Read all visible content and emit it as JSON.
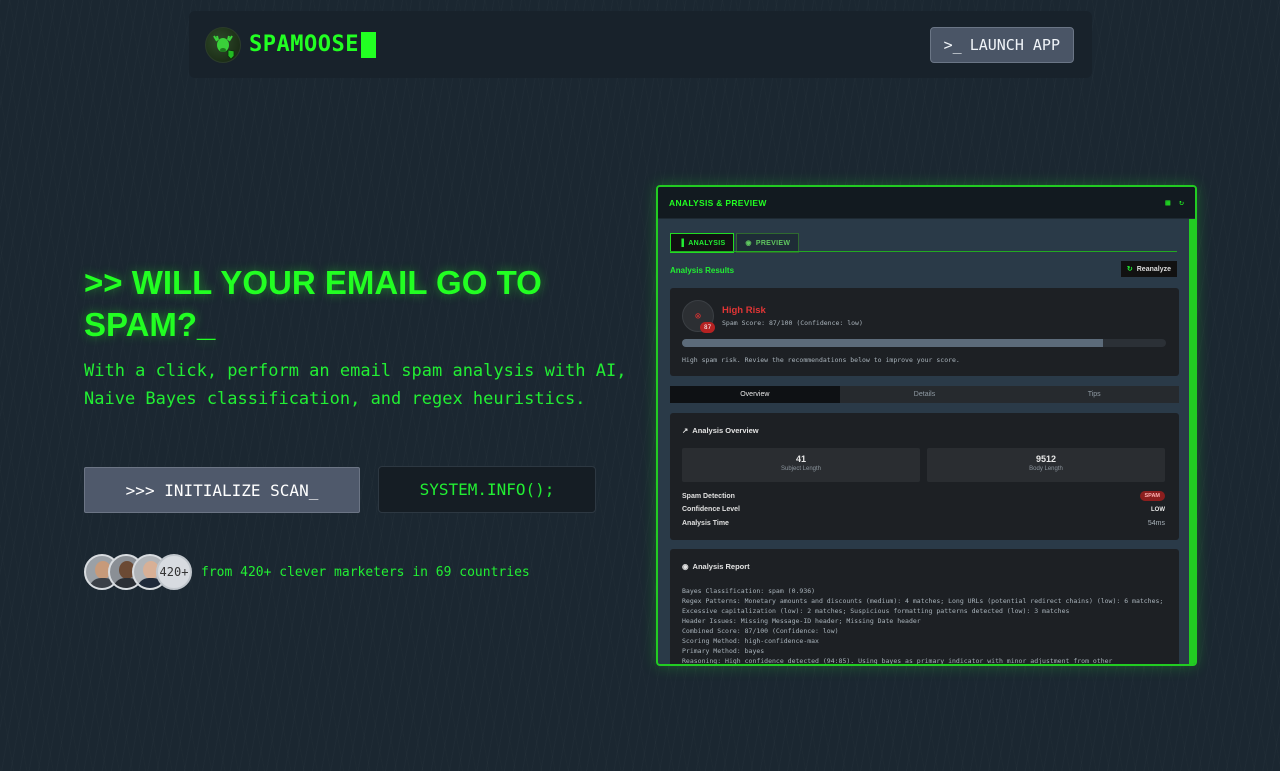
{
  "nav": {
    "brand": "SPAMOOSE",
    "launch_label": "LAUNCH APP",
    "launch_icon": "terminal-icon"
  },
  "hero": {
    "title_line1": ">> WILL YOUR EMAIL GO TO",
    "title_line2": "SPAM?_",
    "subtitle": "With a click, perform an email spam analysis with AI, Naive Bayes classification, and regex heuristics.",
    "primary_button": ">>> INITIALIZE SCAN_",
    "secondary_button": "SYSTEM.INFO();",
    "avatar_count": "420+",
    "social_text": "from 420+ clever marketers in 69 countries"
  },
  "colors": {
    "accent": "#22ff22",
    "background": "#1b2731",
    "danger": "#e03535"
  },
  "panel": {
    "title": "ANALYSIS & PREVIEW",
    "tabs": [
      {
        "label": "ANALYSIS",
        "icon": "bar-chart-icon",
        "active": true
      },
      {
        "label": "PREVIEW",
        "icon": "eye-icon",
        "active": false
      }
    ],
    "results_label": "Analysis Results",
    "reanalyze_label": "Reanalyze",
    "risk": {
      "title": "High Risk",
      "score_text": "Spam Score: 87/100 (Confidence: low)",
      "badge": "87",
      "progress": 0.87,
      "message": "High spam risk. Review the recommendations below to improve your score."
    },
    "subtabs": [
      "Overview",
      "Details",
      "Tips"
    ],
    "overview": {
      "title": "Analysis Overview",
      "stats": [
        {
          "value": "41",
          "label": "Subject Length"
        },
        {
          "value": "9512",
          "label": "Body Length"
        }
      ],
      "rows": [
        {
          "key": "Spam Detection",
          "value": "SPAM"
        },
        {
          "key": "Confidence Level",
          "value": "LOW"
        },
        {
          "key": "Analysis Time",
          "value": "54ms"
        }
      ]
    },
    "report": {
      "title": "Analysis Report",
      "lines": [
        "Bayes Classification: spam (0.936)",
        "Regex Patterns: Monetary amounts and discounts (medium): 4 matches; Long URLs (potential redirect chains) (low): 6 matches; Excessive capitalization (low): 2 matches; Suspicious formatting patterns detected (low): 3 matches",
        "Header Issues: Missing Message-ID header; Missing Date header",
        "Combined Score: 87/100 (Confidence: low)",
        "Scoring Method: high-confidence-max",
        "Primary Method: bayes",
        "Reasoning: High confidence detected (94:85). Using bayes as primary indicator with minor adjustment from other"
      ]
    }
  }
}
